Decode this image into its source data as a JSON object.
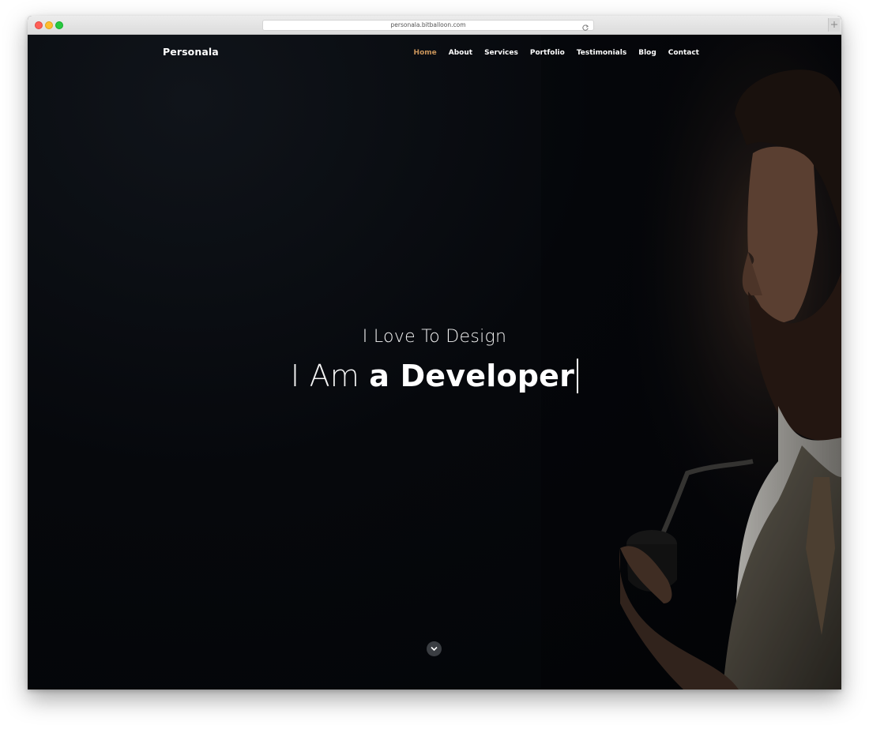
{
  "browser": {
    "url": "personala.bitballoon.com"
  },
  "site": {
    "brand": "Personala",
    "accent_color": "#c9945a",
    "nav": [
      {
        "label": "Home",
        "active": true
      },
      {
        "label": "About",
        "active": false
      },
      {
        "label": "Services",
        "active": false
      },
      {
        "label": "Portfolio",
        "active": false
      },
      {
        "label": "Testimonials",
        "active": false
      },
      {
        "label": "Blog",
        "active": false
      },
      {
        "label": "Contact",
        "active": false
      }
    ]
  },
  "hero": {
    "line1": "I Love To Design",
    "line2_prefix": "I Am",
    "line2_typed": "a Developer"
  },
  "icons": {
    "scroll": "chevron-down-icon",
    "reload": "reload-icon"
  }
}
